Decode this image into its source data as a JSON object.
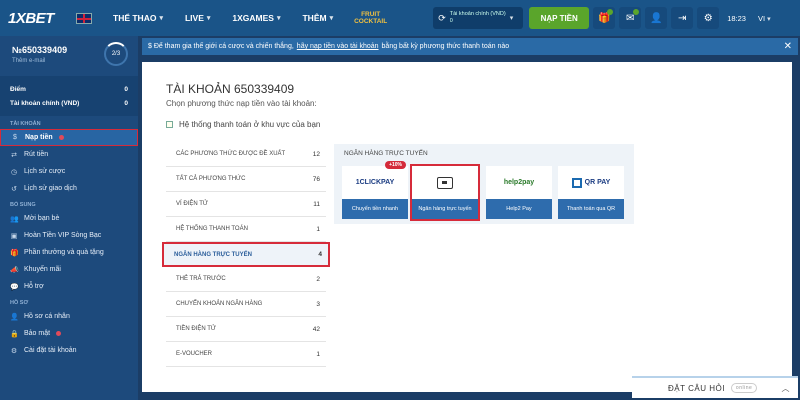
{
  "topbar": {
    "logo": "1XBET",
    "nav": [
      {
        "label": "THỂ THAO"
      },
      {
        "label": "LIVE"
      },
      {
        "label": "1XGAMES"
      },
      {
        "label": "THÊM"
      }
    ],
    "cocktail": [
      "FRUIT",
      "COCKTAIL"
    ],
    "account_select": [
      "Tài khoản chính (VND)",
      "0"
    ],
    "deposit_button": "NẠP TIỀN",
    "time": "18:23",
    "language": "VI"
  },
  "sidebar": {
    "account_number": "№650339409",
    "add_email": "Thêm e-mail",
    "progress": "2/3",
    "stats": [
      {
        "label": "Điểm",
        "value": "0"
      },
      {
        "label": "Tài khoản chính (VND)",
        "value": "0"
      }
    ],
    "section_account": "TÀI KHOẢN",
    "account_items": [
      "Nạp tiền",
      "Rút tiền",
      "Lịch sử cược",
      "Lịch sử giao dịch"
    ],
    "section_extra": "BỔ SUNG",
    "extra_items": [
      "Mời bạn bè",
      "Hoàn Tiền VIP Sòng Bạc",
      "Phần thưởng và quà tặng",
      "Khuyến mãi",
      "Hỗ trợ"
    ],
    "section_profile": "HỒ SƠ",
    "profile_items": [
      "Hồ sơ cá nhân",
      "Bảo mật",
      "Cài đặt tài khoản"
    ]
  },
  "notice": {
    "text_before": "Để tham gia thế giới cá cược và chiến thắng,",
    "link": "hãy nạp tiền vào tài khoản",
    "text_after": "bằng bất kỳ phương thức thanh toán nào"
  },
  "panel": {
    "title": "TÀI KHOẢN 650339409",
    "subtitle": "Chọn phương thức nạp tiền vào tài khoản:",
    "region": "Hệ thống thanh toán ở khu vực của bạn",
    "methods": [
      {
        "label": "CÁC PHƯƠNG THỨC ĐƯỢC ĐỀ XUẤT",
        "count": "12"
      },
      {
        "label": "TẤT CẢ PHƯƠNG THỨC",
        "count": "76"
      },
      {
        "label": "VÍ ĐIỆN TỬ",
        "count": "11"
      },
      {
        "label": "HỆ THỐNG THANH TOÁN",
        "count": "1"
      },
      {
        "label": "NGÂN HÀNG TRỰC TUYẾN",
        "count": "4"
      },
      {
        "label": "THẺ TRẢ TRƯỚC",
        "count": "2"
      },
      {
        "label": "CHUYỂN KHOẢN NGÂN HÀNG",
        "count": "3"
      },
      {
        "label": "TIỀN ĐIỆN TỬ",
        "count": "42"
      },
      {
        "label": "E-VOUCHER",
        "count": "1"
      }
    ],
    "bank_title": "NGÂN HÀNG TRỰC TUYẾN",
    "banks": [
      {
        "logo": "1CLICKPAY",
        "label": "Chuyển tiền nhanh",
        "bonus": "+10%"
      },
      {
        "logo": "",
        "label": "Ngân hàng trực tuyến"
      },
      {
        "logo": "help2pay",
        "label": "Help2 Pay"
      },
      {
        "logo": "QR PAY",
        "label": "Thanh toán qua QR"
      }
    ]
  },
  "ask": {
    "label": "ĐẶT CÂU HỎI",
    "status": "online"
  },
  "colors": {
    "accent": "#5aa52b",
    "highlight": "#d62b3a",
    "brand": "#1a5488"
  }
}
